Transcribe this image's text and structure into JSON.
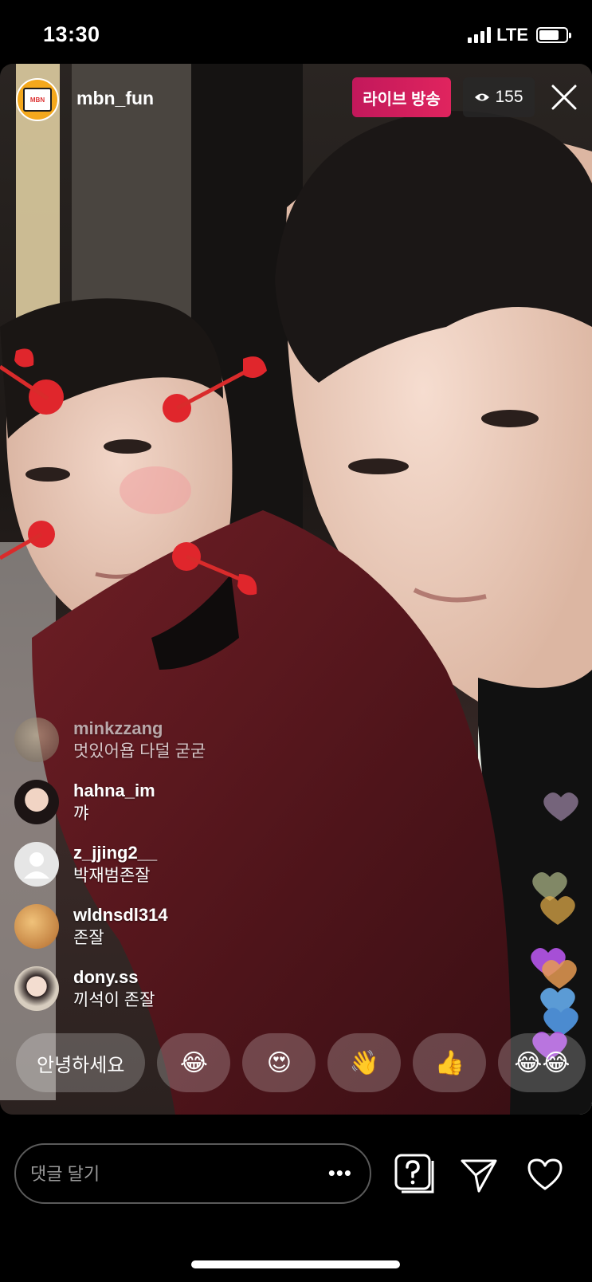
{
  "status_bar": {
    "time": "13:30",
    "network": "LTE"
  },
  "live": {
    "host_username": "mbn_fun",
    "live_badge": "라이브 방송",
    "viewer_count": "155"
  },
  "comments": [
    {
      "username": "minkzzang",
      "message": "멋있어욥 다덜 굳굳"
    },
    {
      "username": "hahna_im",
      "message": "꺄"
    },
    {
      "username": "z_jjing2__",
      "message": "박재범존잘"
    },
    {
      "username": "wldnsdl314",
      "message": "존잘"
    },
    {
      "username": "dony.ss",
      "message": "끼석이 존잘"
    }
  ],
  "quick_reactions": {
    "text_chip": "안녕하세요",
    "emoji_chips": [
      "😂",
      "😍",
      "👋",
      "👍",
      "😂😂"
    ]
  },
  "bottom_bar": {
    "comment_placeholder": "댓글 달기",
    "more_label": "•••"
  },
  "colors": {
    "live_badge": "#e0245e",
    "heart_purple": "#a64fd6",
    "heart_blue": "#5b9bd5",
    "heart_gold": "#e8b04a"
  }
}
